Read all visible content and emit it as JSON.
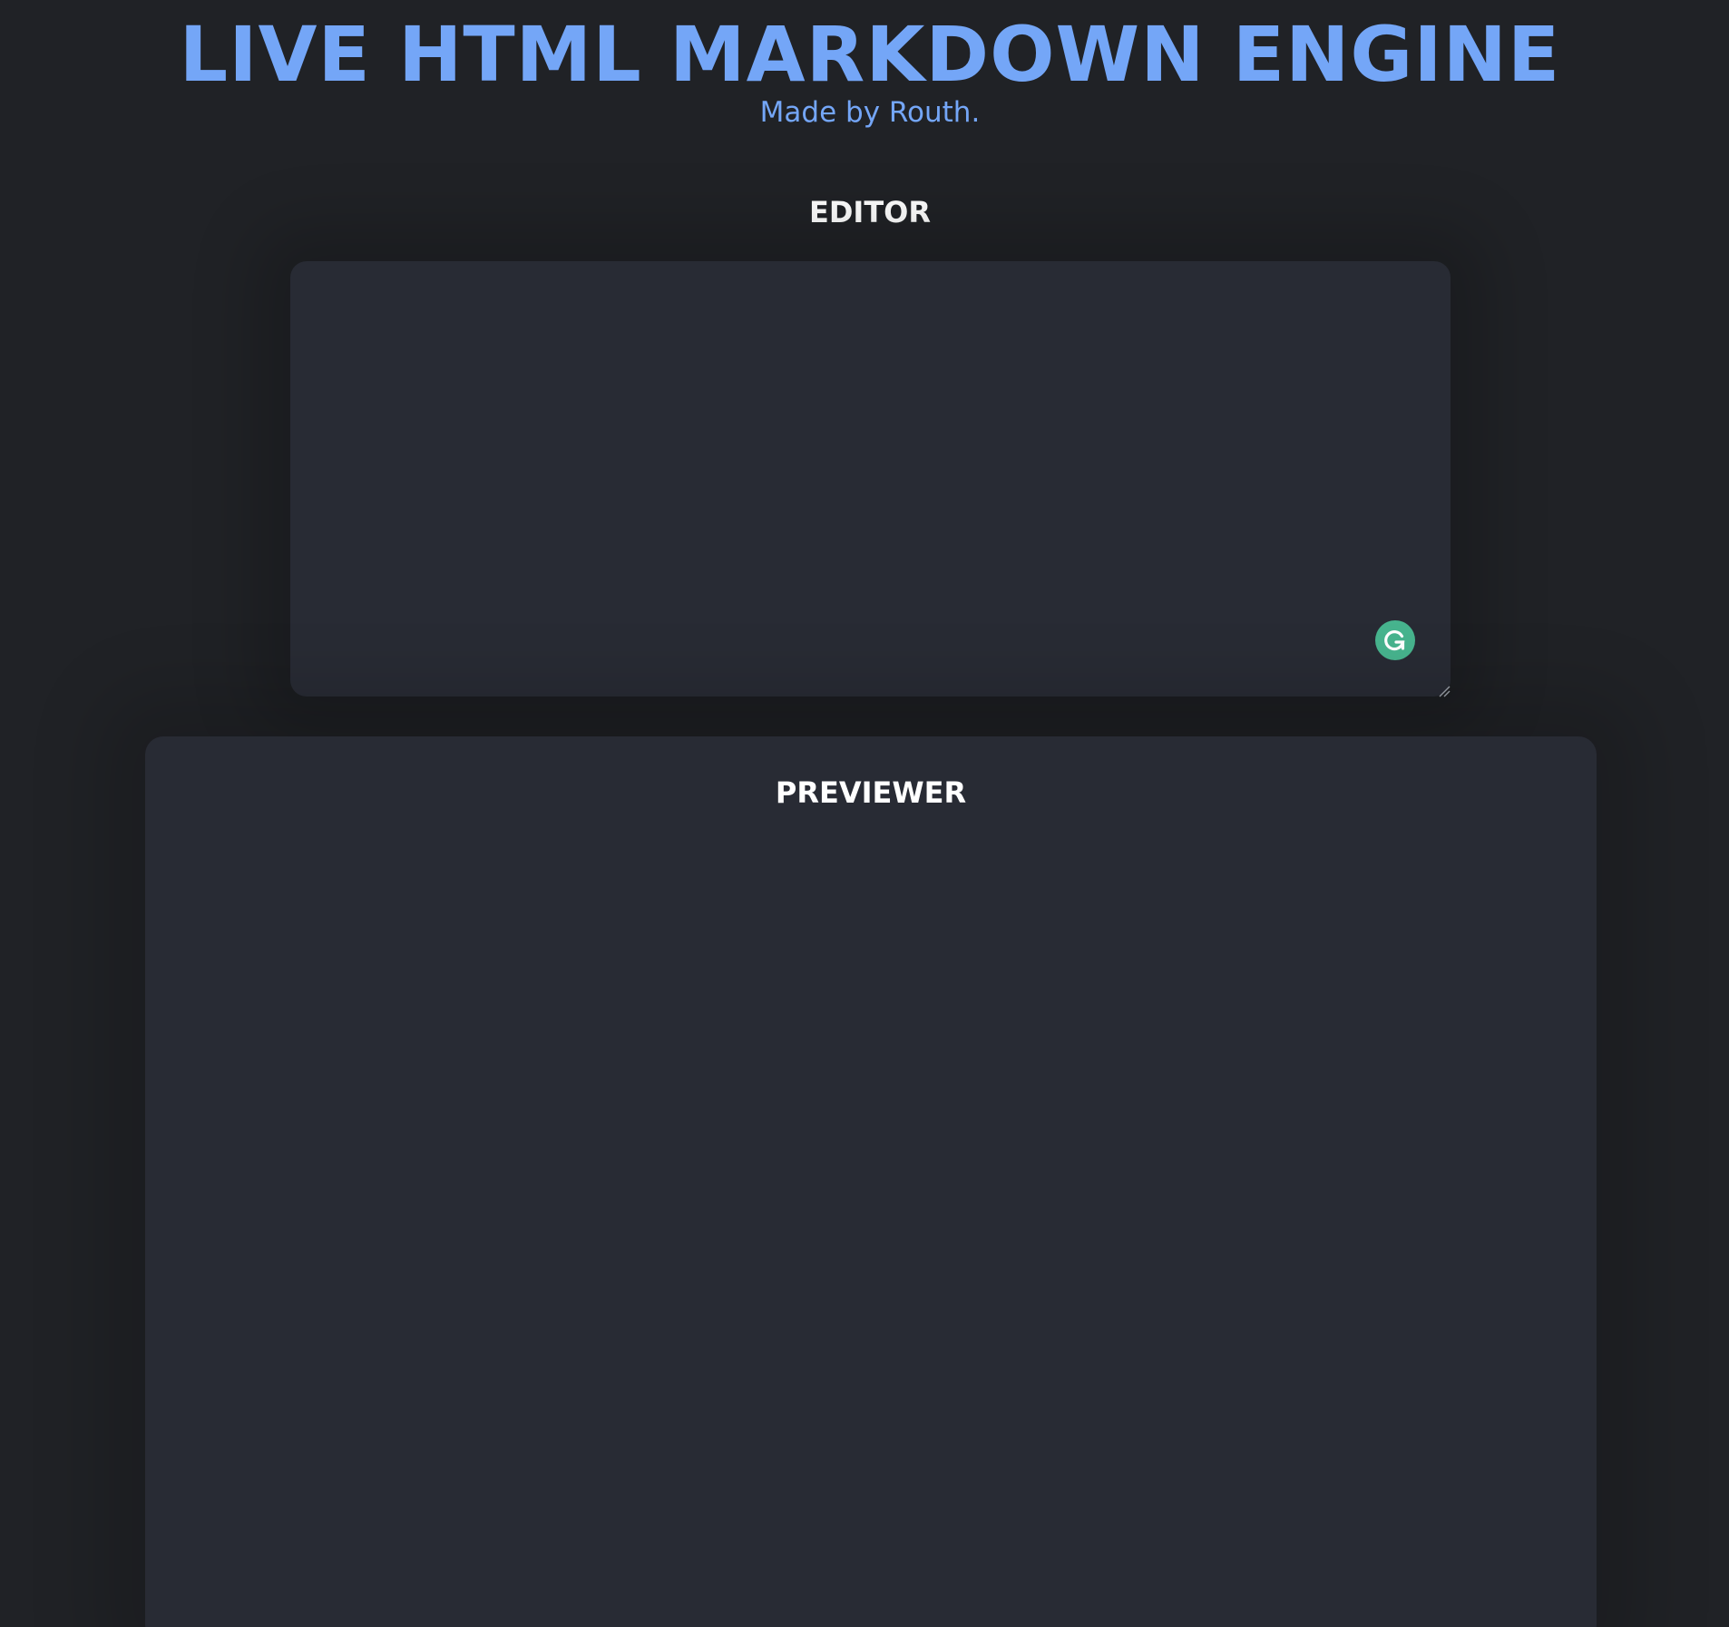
{
  "header": {
    "title": "LIVE HTML MARKDOWN ENGINE",
    "subtitle": "Made by Routh."
  },
  "editor": {
    "label": "EDITOR",
    "value": "",
    "assistant_icon": "grammarly-icon"
  },
  "previewer": {
    "label": "PREVIEWER",
    "content": ""
  },
  "colors": {
    "page_background": "#202226",
    "panel_background": "#282b34",
    "accent": "#74a6f7",
    "heading_text": "#ffffff",
    "grammarly": "#47b48e"
  }
}
